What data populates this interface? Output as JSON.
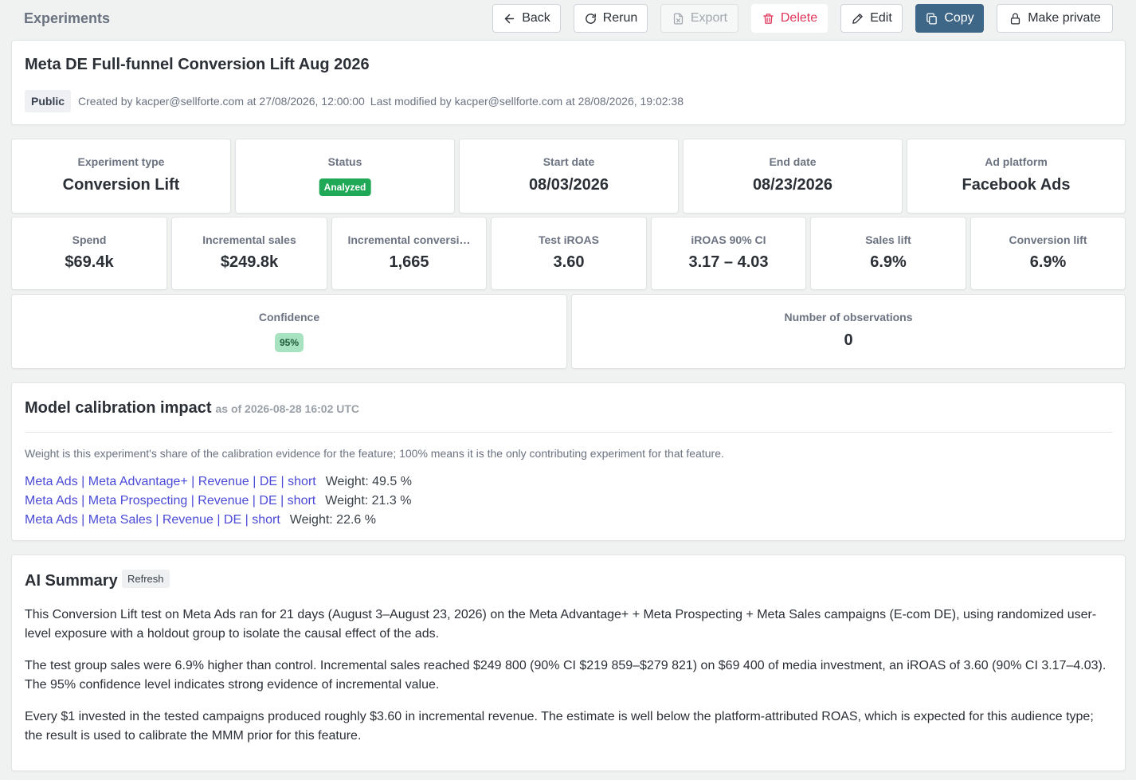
{
  "page": {
    "title": "Experiments"
  },
  "toolbar": {
    "back": "Back",
    "rerun": "Rerun",
    "export": "Export",
    "delete": "Delete",
    "edit": "Edit",
    "copy": "Copy",
    "make_private": "Make private"
  },
  "experiment": {
    "title": "Meta DE Full-funnel Conversion Lift Aug 2026",
    "visibility": "Public",
    "created": "Created by kacper@sellforte.com at 27/08/2026, 12:00:00",
    "modified": "Last modified by kacper@sellforte.com at 28/08/2026, 19:02:38"
  },
  "summary_row": {
    "experiment_type": {
      "label": "Experiment type",
      "value": "Conversion Lift"
    },
    "status": {
      "label": "Status",
      "value": "Analyzed"
    },
    "start_date": {
      "label": "Start date",
      "value": "08/03/2026"
    },
    "end_date": {
      "label": "End date",
      "value": "08/23/2026"
    },
    "ad_platform": {
      "label": "Ad platform",
      "value": "Facebook Ads"
    }
  },
  "metrics": [
    {
      "label": "Spend",
      "value": "$69.4k"
    },
    {
      "label": "Incremental sales",
      "value": "$249.8k"
    },
    {
      "label": "Incremental conversi…",
      "value": "1,665"
    },
    {
      "label": "Test iROAS",
      "value": "3.60"
    },
    {
      "label": "iROAS 90% CI",
      "value": "3.17 – 4.03"
    },
    {
      "label": "Sales lift",
      "value": "6.9%"
    },
    {
      "label": "Conversion lift",
      "value": "6.9%"
    }
  ],
  "confidence": {
    "label": "Confidence",
    "value": "95%"
  },
  "observations": {
    "label": "Number of observations",
    "value": "0"
  },
  "calibration": {
    "title": "Model calibration impact",
    "as_of": "as of 2026-08-28 16:02 UTC",
    "note": "Weight is this experiment's share of the calibration evidence for the feature; 100% means it is the only contributing experiment for that feature.",
    "items": [
      {
        "feature": "Meta Ads | Meta Advantage+ | Revenue | DE | short",
        "weight": "Weight: 49.5 %"
      },
      {
        "feature": "Meta Ads | Meta Prospecting | Revenue | DE | short",
        "weight": "Weight: 21.3 %"
      },
      {
        "feature": "Meta Ads | Meta Sales | Revenue | DE | short",
        "weight": "Weight: 22.6 %"
      }
    ]
  },
  "ai_summary": {
    "title": "AI Summary",
    "refresh": "Refresh",
    "paragraphs": [
      "This Conversion Lift test on Meta Ads ran for 21 days (August 3–August 23, 2026) on the Meta Advantage+ + Meta Prospecting + Meta Sales campaigns (E-com DE), using randomized user-level exposure with a holdout group to isolate the causal effect of the ads.",
      "The test group sales were 6.9% higher than control. Incremental sales reached $249 800 (90% CI $219 859–$279 821) on $69 400 of media investment, an iROAS of 3.60 (90% CI 3.17–4.03). The 95% confidence level indicates strong evidence of incremental value.",
      "Every $1 invested in the tested campaigns produced roughly $3.60 in incremental revenue. The estimate is well below the platform-attributed ROAS, which is expected for this audience type; the result is used to calibrate the MMM prior for this feature."
    ]
  },
  "colors": {
    "primary": "#3e6687",
    "danger": "#e0365a",
    "status_green": "#1fa856",
    "confidence_green": "#a7e2c1",
    "link": "#4b4ad6"
  }
}
